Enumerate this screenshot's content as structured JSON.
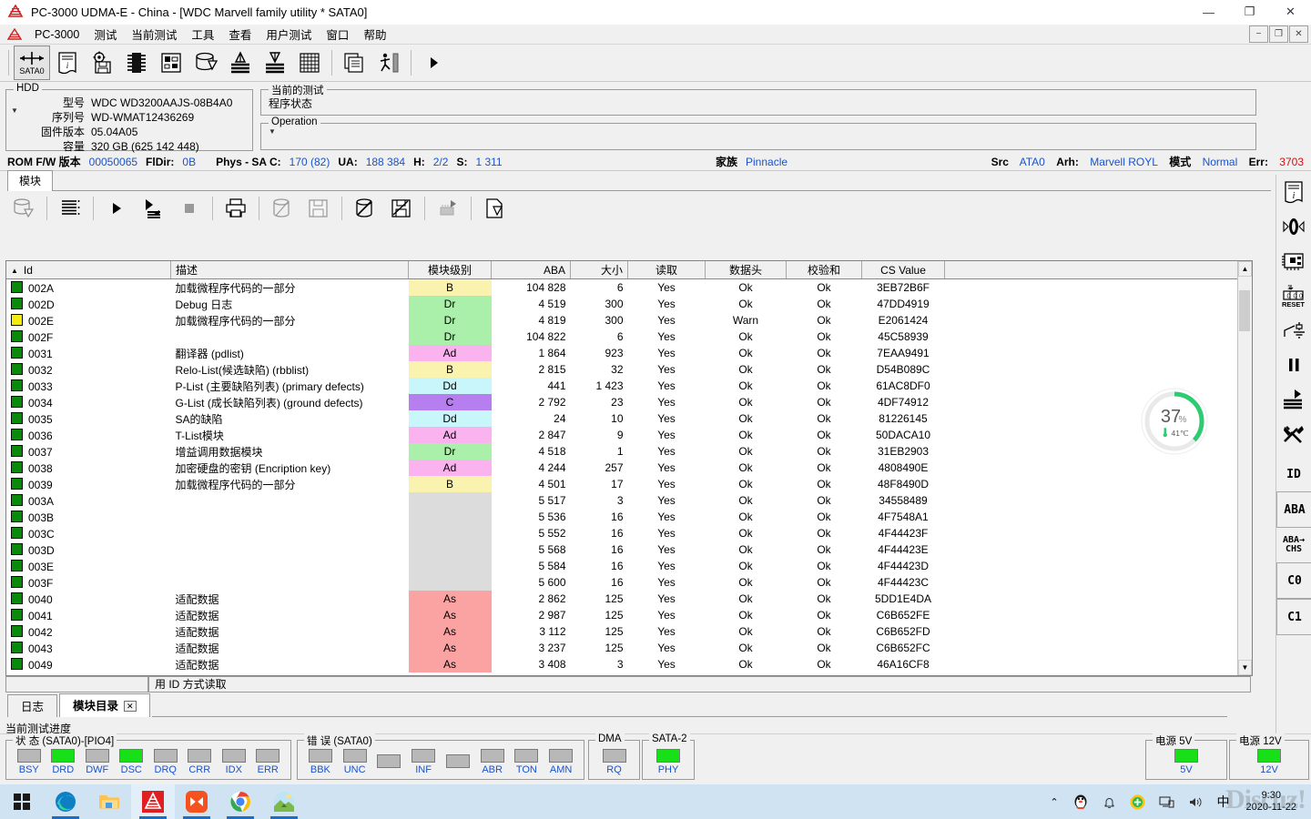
{
  "window": {
    "title": "PC-3000 UDMA-E - China - [WDC Marvell family utility * SATA0]",
    "minimize": "—",
    "maximize": "❐",
    "close": "✕",
    "mdi_minimize": "−",
    "mdi_restore": "❐",
    "mdi_close": "✕"
  },
  "menu": {
    "items": [
      {
        "label": "PC-3000"
      },
      {
        "label": "测试"
      },
      {
        "label": "当前测试"
      },
      {
        "label": "工具"
      },
      {
        "label": "查看"
      },
      {
        "label": "用户测试"
      },
      {
        "label": "窗口"
      },
      {
        "label": "帮助"
      }
    ]
  },
  "toolbar": {
    "sata_label": "SATA0",
    "items": [
      {
        "name": "sata0-port-button",
        "label": "SATA0"
      },
      {
        "name": "drive-id-button",
        "label": ""
      },
      {
        "name": "utility-settings-button",
        "label": ""
      },
      {
        "name": "rom-chip-button",
        "label": ""
      },
      {
        "name": "hardware-info-button",
        "label": ""
      },
      {
        "name": "disk-eject-button",
        "label": ""
      },
      {
        "name": "read-test-button",
        "label": ""
      },
      {
        "name": "write-test-button",
        "label": ""
      },
      {
        "name": "sector-map-button",
        "label": ""
      },
      {
        "name": "copy-button",
        "label": ""
      },
      {
        "name": "data-extractor-button",
        "label": ""
      },
      {
        "name": "run-button",
        "label": "▶"
      }
    ]
  },
  "hdd": {
    "group_label": "HDD",
    "rows": [
      {
        "label": "型号",
        "value": "WDC WD3200AAJS-08B4A0"
      },
      {
        "label": "序列号",
        "value": "WD-WMAT12436269"
      },
      {
        "label": "固件版本",
        "value": "05.04A05"
      },
      {
        "label": "容量",
        "value": "320 GB (625 142 448)"
      }
    ]
  },
  "current_test": {
    "group_label": "当前的测试",
    "status_label": "程序状态",
    "status_value": "",
    "operation_label": "Operation",
    "operation_value": ""
  },
  "rom_line": {
    "rom_fw_label": "ROM F/W 版本",
    "rom_fw_value": "00050065",
    "fldir_label": "FlDir:",
    "fldir_value": "0B",
    "phys_label": "Phys - SA C:",
    "phys_value": "170 (82)",
    "ua_label": "UA:",
    "ua_value": "188 384",
    "h_label": "H:",
    "h_value": "2/2",
    "s_label": "S:",
    "s_value": "1 311",
    "family_label": "家族",
    "family_value": "Pinnacle",
    "src_label": "Src",
    "src_value": "ATA0",
    "arh_label": "Arh:",
    "arh_value": "Marvell ROYL",
    "mode_label": "模式",
    "mode_value": "Normal",
    "err_label": "Err:",
    "err_value": "3703"
  },
  "client_tab": {
    "label": "模块"
  },
  "module_toolbar": {
    "items": [
      {
        "name": "load-modules-button"
      },
      {
        "name": "list-view-button"
      },
      {
        "name": "read-module-button"
      },
      {
        "name": "read-all-modules-button"
      },
      {
        "name": "stop-button"
      },
      {
        "name": "print-button"
      },
      {
        "name": "copy-module-button"
      },
      {
        "name": "save-module-button"
      },
      {
        "name": "write-module-button"
      },
      {
        "name": "write-module-file-button"
      },
      {
        "name": "module-chip-button"
      },
      {
        "name": "export-button"
      }
    ]
  },
  "table": {
    "columns": [
      {
        "key": "id",
        "label": "Id",
        "sorted": true,
        "sort_arrow": "▲"
      },
      {
        "key": "desc",
        "label": "描述"
      },
      {
        "key": "level",
        "label": "模块级别"
      },
      {
        "key": "aba",
        "label": "ABA"
      },
      {
        "key": "size",
        "label": "大小"
      },
      {
        "key": "read",
        "label": "读取"
      },
      {
        "key": "header",
        "label": "数据头"
      },
      {
        "key": "checksum",
        "label": "校验和"
      },
      {
        "key": "cs",
        "label": "CS Value"
      },
      {
        "key": "extra",
        "label": ""
      }
    ],
    "rows": [
      {
        "chip": "#0a8a0a",
        "id": "002A",
        "desc": "加载微程序代码的一部分",
        "level": "B",
        "lvlcolor": "#faf3b0",
        "aba": "104 828",
        "size": "6",
        "read": "Yes",
        "header": "Ok",
        "checksum": "Ok",
        "cs": "3EB72B6F"
      },
      {
        "chip": "#0a8a0a",
        "id": "002D",
        "desc": "Debug 日志",
        "level": "Dr",
        "lvlcolor": "#aaf0aa",
        "aba": "4 519",
        "size": "300",
        "read": "Yes",
        "header": "Ok",
        "checksum": "Ok",
        "cs": "47DD4919"
      },
      {
        "chip": "#f2ec12",
        "id": "002E",
        "desc": "加载微程序代码的一部分",
        "level": "Dr",
        "lvlcolor": "#aaf0aa",
        "aba": "4 819",
        "size": "300",
        "read": "Yes",
        "header": "Warn",
        "checksum": "Ok",
        "cs": "E2061424"
      },
      {
        "chip": "#0a8a0a",
        "id": "002F",
        "desc": "",
        "level": "Dr",
        "lvlcolor": "#aaf0aa",
        "aba": "104 822",
        "size": "6",
        "read": "Yes",
        "header": "Ok",
        "checksum": "Ok",
        "cs": "45C58939"
      },
      {
        "chip": "#0a8a0a",
        "id": "0031",
        "desc": "翻译器 (pdlist)",
        "level": "Ad",
        "lvlcolor": "#fbb3f0",
        "aba": "1 864",
        "size": "923",
        "read": "Yes",
        "header": "Ok",
        "checksum": "Ok",
        "cs": "7EAA9491"
      },
      {
        "chip": "#0a8a0a",
        "id": "0032",
        "desc": "Relo-List(候选缺陷) (rbblist)",
        "level": "B",
        "lvlcolor": "#faf3b0",
        "aba": "2 815",
        "size": "32",
        "read": "Yes",
        "header": "Ok",
        "checksum": "Ok",
        "cs": "D54B089C"
      },
      {
        "chip": "#0a8a0a",
        "id": "0033",
        "desc": "P-List (主要缺陷列表) (primary defects)",
        "level": "Dd",
        "lvlcolor": "#c8f6fb",
        "aba": "441",
        "size": "1 423",
        "read": "Yes",
        "header": "Ok",
        "checksum": "Ok",
        "cs": "61AC8DF0"
      },
      {
        "chip": "#0a8a0a",
        "id": "0034",
        "desc": "G-List (成长缺陷列表) (ground defects)",
        "level": "C",
        "lvlcolor": "#b77ef0",
        "aba": "2 792",
        "size": "23",
        "read": "Yes",
        "header": "Ok",
        "checksum": "Ok",
        "cs": "4DF74912"
      },
      {
        "chip": "#0a8a0a",
        "id": "0035",
        "desc": "SA的缺陷",
        "level": "Dd",
        "lvlcolor": "#c8f6fb",
        "aba": "24",
        "size": "10",
        "read": "Yes",
        "header": "Ok",
        "checksum": "Ok",
        "cs": "81226145"
      },
      {
        "chip": "#0a8a0a",
        "id": "0036",
        "desc": "T-List模块",
        "level": "Ad",
        "lvlcolor": "#fbb3f0",
        "aba": "2 847",
        "size": "9",
        "read": "Yes",
        "header": "Ok",
        "checksum": "Ok",
        "cs": "50DACA10"
      },
      {
        "chip": "#0a8a0a",
        "id": "0037",
        "desc": "增益调用数据模块",
        "level": "Dr",
        "lvlcolor": "#aaf0aa",
        "aba": "4 518",
        "size": "1",
        "read": "Yes",
        "header": "Ok",
        "checksum": "Ok",
        "cs": "31EB2903"
      },
      {
        "chip": "#0a8a0a",
        "id": "0038",
        "desc": "加密硬盘的密钥 (Encription key)",
        "level": "Ad",
        "lvlcolor": "#fbb3f0",
        "aba": "4 244",
        "size": "257",
        "read": "Yes",
        "header": "Ok",
        "checksum": "Ok",
        "cs": "4808490E"
      },
      {
        "chip": "#0a8a0a",
        "id": "0039",
        "desc": "加载微程序代码的一部分",
        "level": "B",
        "lvlcolor": "#faf3b0",
        "aba": "4 501",
        "size": "17",
        "read": "Yes",
        "header": "Ok",
        "checksum": "Ok",
        "cs": "48F8490D"
      },
      {
        "chip": "#0a8a0a",
        "id": "003A",
        "desc": "",
        "level": "",
        "lvlcolor": "#dcdcdc",
        "aba": "5 517",
        "size": "3",
        "read": "Yes",
        "header": "Ok",
        "checksum": "Ok",
        "cs": "34558489"
      },
      {
        "chip": "#0a8a0a",
        "id": "003B",
        "desc": "",
        "level": "",
        "lvlcolor": "#dcdcdc",
        "aba": "5 536",
        "size": "16",
        "read": "Yes",
        "header": "Ok",
        "checksum": "Ok",
        "cs": "4F7548A1"
      },
      {
        "chip": "#0a8a0a",
        "id": "003C",
        "desc": "",
        "level": "",
        "lvlcolor": "#dcdcdc",
        "aba": "5 552",
        "size": "16",
        "read": "Yes",
        "header": "Ok",
        "checksum": "Ok",
        "cs": "4F44423F"
      },
      {
        "chip": "#0a8a0a",
        "id": "003D",
        "desc": "",
        "level": "",
        "lvlcolor": "#dcdcdc",
        "aba": "5 568",
        "size": "16",
        "read": "Yes",
        "header": "Ok",
        "checksum": "Ok",
        "cs": "4F44423E"
      },
      {
        "chip": "#0a8a0a",
        "id": "003E",
        "desc": "",
        "level": "",
        "lvlcolor": "#dcdcdc",
        "aba": "5 584",
        "size": "16",
        "read": "Yes",
        "header": "Ok",
        "checksum": "Ok",
        "cs": "4F44423D"
      },
      {
        "chip": "#0a8a0a",
        "id": "003F",
        "desc": "",
        "level": "",
        "lvlcolor": "#dcdcdc",
        "aba": "5 600",
        "size": "16",
        "read": "Yes",
        "header": "Ok",
        "checksum": "Ok",
        "cs": "4F44423C"
      },
      {
        "chip": "#0a8a0a",
        "id": "0040",
        "desc": "适配数据",
        "level": "As",
        "lvlcolor": "#fba3a3",
        "aba": "2 862",
        "size": "125",
        "read": "Yes",
        "header": "Ok",
        "checksum": "Ok",
        "cs": "5DD1E4DA"
      },
      {
        "chip": "#0a8a0a",
        "id": "0041",
        "desc": "适配数据",
        "level": "As",
        "lvlcolor": "#fba3a3",
        "aba": "2 987",
        "size": "125",
        "read": "Yes",
        "header": "Ok",
        "checksum": "Ok",
        "cs": "C6B652FE"
      },
      {
        "chip": "#0a8a0a",
        "id": "0042",
        "desc": "适配数据",
        "level": "As",
        "lvlcolor": "#fba3a3",
        "aba": "3 112",
        "size": "125",
        "read": "Yes",
        "header": "Ok",
        "checksum": "Ok",
        "cs": "C6B652FD"
      },
      {
        "chip": "#0a8a0a",
        "id": "0043",
        "desc": "适配数据",
        "level": "As",
        "lvlcolor": "#fba3a3",
        "aba": "3 237",
        "size": "125",
        "read": "Yes",
        "header": "Ok",
        "checksum": "Ok",
        "cs": "C6B652FC"
      },
      {
        "chip": "#0a8a0a",
        "id": "0049",
        "desc": "适配数据",
        "level": "As",
        "lvlcolor": "#fba3a3",
        "aba": "3 408",
        "size": "3",
        "read": "Yes",
        "header": "Ok",
        "checksum": "Ok",
        "cs": "46A16CF8"
      }
    ]
  },
  "underbar": {
    "left_value": "",
    "right_value": "用  ID   方式读取"
  },
  "bottom_tabs": [
    {
      "label": "日志",
      "active": false,
      "closable": false
    },
    {
      "label": "模块目录",
      "active": true,
      "closable": true,
      "close": "✕"
    }
  ],
  "progress": {
    "label": "当前测试进度",
    "value": 0
  },
  "sidebar": {
    "items": [
      {
        "name": "drive-id-icon",
        "label": ""
      },
      {
        "name": "power-toggle-icon",
        "label": ""
      },
      {
        "name": "pcb-chip-icon",
        "label": ""
      },
      {
        "name": "reset-counter-icon",
        "label": "RESET"
      },
      {
        "name": "ground-switch-icon",
        "label": ""
      },
      {
        "name": "pause-icon",
        "label": "❙❙"
      },
      {
        "name": "run-test-icon",
        "label": ""
      },
      {
        "name": "tools-icon",
        "label": ""
      },
      {
        "name": "id-button",
        "label": "ID"
      },
      {
        "name": "aba-button",
        "label": "ABA"
      },
      {
        "name": "aba-chs-button",
        "label": "ABA→CHS"
      },
      {
        "name": "c0-button",
        "label": "C0"
      },
      {
        "name": "c1-button",
        "label": "C1"
      }
    ],
    "aba_chs_line1": "ABA→",
    "aba_chs_line2": "CHS",
    "dropdown_caret": "▼"
  },
  "gauge": {
    "percent": "37",
    "percent_symbol": "%",
    "temperature": "41℃",
    "ring_color": "#2ecc71",
    "progress": 37
  },
  "status_panels": {
    "state": {
      "label": "状  态 (SATA0)-[PIO4]",
      "leds": [
        {
          "label": "BSY",
          "on": false
        },
        {
          "label": "DRD",
          "on": true
        },
        {
          "label": "DWF",
          "on": false
        },
        {
          "label": "DSC",
          "on": true
        },
        {
          "label": "DRQ",
          "on": false
        },
        {
          "label": "CRR",
          "on": false
        },
        {
          "label": "IDX",
          "on": false
        },
        {
          "label": "ERR",
          "on": false
        }
      ]
    },
    "error": {
      "label": "错  误 (SATA0)",
      "leds": [
        {
          "label": "BBK",
          "on": false
        },
        {
          "label": "UNC",
          "on": false
        },
        {
          "label": "",
          "on": false
        },
        {
          "label": "INF",
          "on": false
        },
        {
          "label": "",
          "on": false
        },
        {
          "label": "ABR",
          "on": false
        },
        {
          "label": "TON",
          "on": false
        },
        {
          "label": "AMN",
          "on": false
        }
      ]
    },
    "dma": {
      "label": "DMA",
      "leds": [
        {
          "label": "RQ",
          "on": false
        }
      ]
    },
    "sata2": {
      "label": "SATA-2",
      "leds": [
        {
          "label": "PHY",
          "on": true
        }
      ]
    },
    "power5v": {
      "label": "电源 5V",
      "leds": [
        {
          "label": "5V",
          "on": true
        }
      ]
    },
    "power12v": {
      "label": "电源 12V",
      "leds": [
        {
          "label": "12V",
          "on": true
        }
      ]
    }
  },
  "taskbar": {
    "items": [
      {
        "name": "start-button"
      },
      {
        "name": "edge-browser"
      },
      {
        "name": "file-explorer"
      },
      {
        "name": "pc3000-app"
      },
      {
        "name": "foxmail-app"
      },
      {
        "name": "chrome-browser"
      },
      {
        "name": "photo-viewer"
      }
    ],
    "tray": [
      {
        "name": "show-hidden-icons",
        "glyph": "⌃"
      },
      {
        "name": "qq-icon"
      },
      {
        "name": "notification-bell"
      },
      {
        "name": "security-icon"
      },
      {
        "name": "network-icon"
      },
      {
        "name": "volume-icon"
      },
      {
        "name": "ime-indicator",
        "glyph": "中"
      }
    ],
    "clock_time": "9:30",
    "clock_date": "2020-11-22",
    "watermark": "Discuz!"
  }
}
